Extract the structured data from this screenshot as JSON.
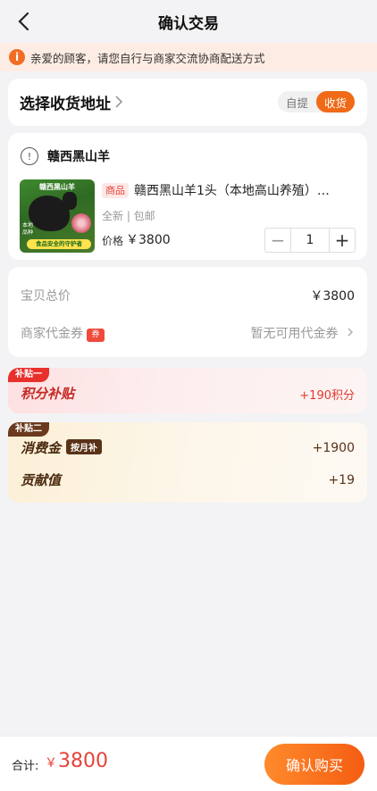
{
  "header": {
    "title": "确认交易"
  },
  "notice": {
    "text": "亲爱的顾客，请您自行与商家交流协商配送方式"
  },
  "address": {
    "label": "选择收货地址",
    "options": [
      "自提",
      "收货"
    ],
    "selected": "收货"
  },
  "product": {
    "seller": "赣西黑山羊",
    "image_text": {
      "title": "赣西黑山羊",
      "side": "本地\n品种",
      "badge": "食品安全的守护者"
    },
    "tag": "商品",
    "name": "赣西黑山羊1头（本地高山养殖）…",
    "meta": "全新 | 包邮",
    "price_label": "价格",
    "price": "￥3800",
    "quantity": "1"
  },
  "summary": {
    "total_label": "宝贝总价",
    "total_value": "￥3800",
    "voucher_label": "商家代金券",
    "voucher_badge": "券",
    "voucher_value": "暂无可用代金券"
  },
  "subsidy_one": {
    "tag": "补贴一",
    "label": "积分补贴",
    "value": "+190积分"
  },
  "subsidy_two": {
    "tag": "补贴二",
    "consumption_label": "消费金",
    "consumption_badge": "按月补",
    "consumption_value": "+1900",
    "contribution_label": "贡献值",
    "contribution_value": "+19"
  },
  "footer": {
    "total_label": "合计:",
    "currency": "￥",
    "total_amount": "3800",
    "buy_button": "确认购买"
  },
  "colors": {
    "accent": "#f06a18",
    "price_red": "#e5433b",
    "notice_bg": "#fdece3"
  }
}
